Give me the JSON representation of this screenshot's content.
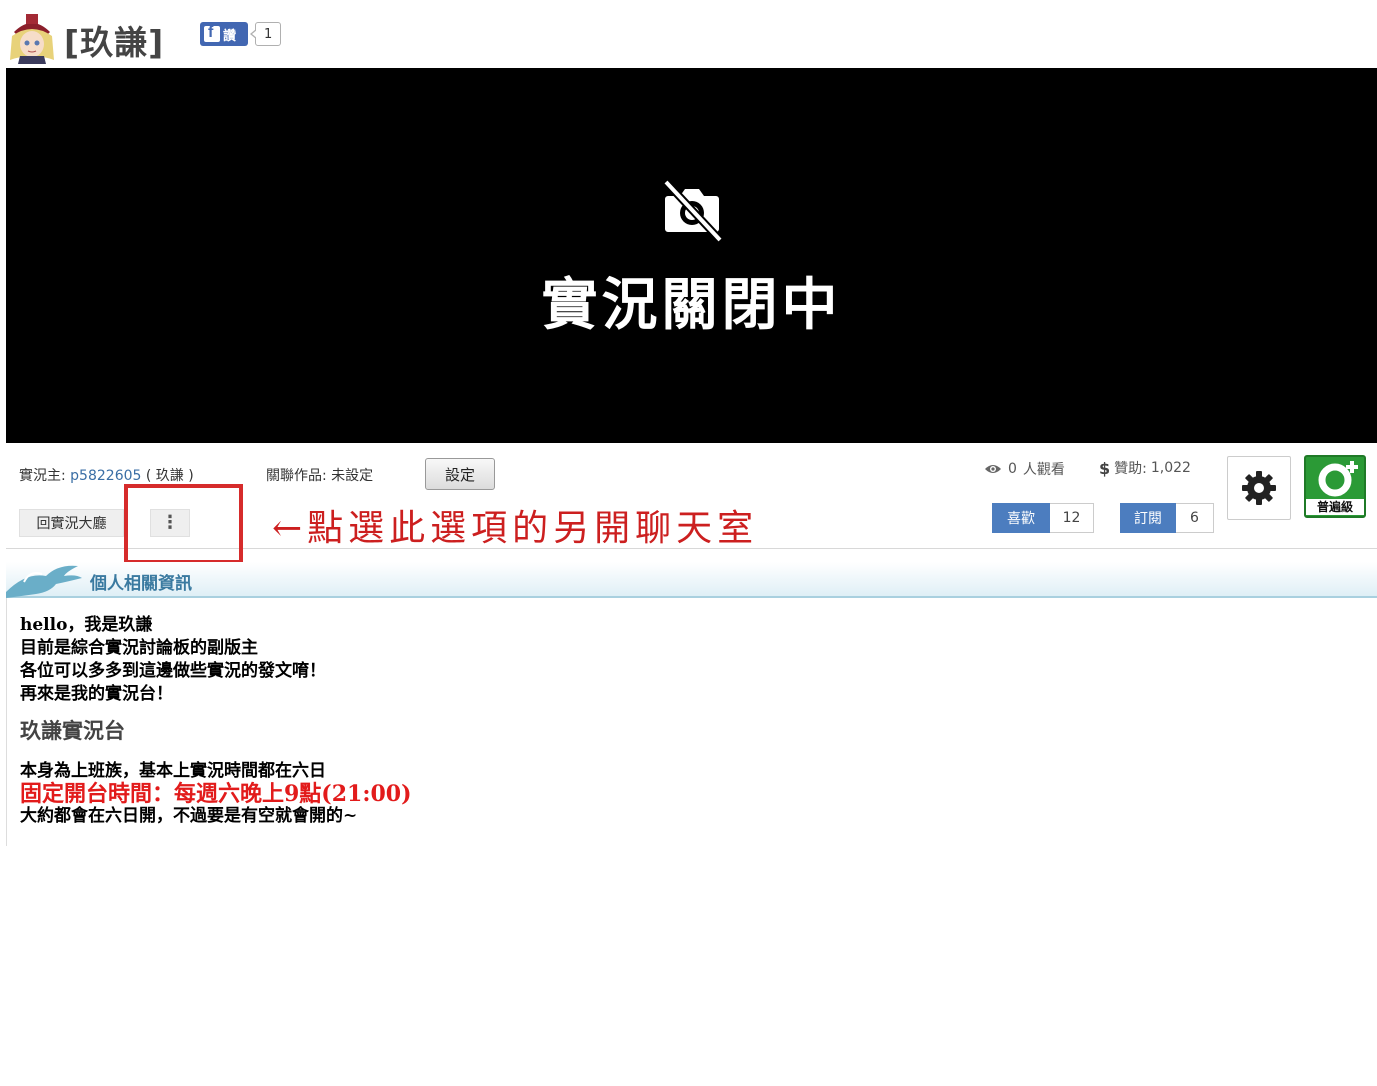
{
  "header": {
    "title": "[玖謙]",
    "fb_label": "讚",
    "fb_count": "1"
  },
  "player": {
    "status_text": "實況關閉中"
  },
  "info": {
    "streamer_label": "實況主:",
    "streamer_id": "p5822605",
    "streamer_name": "( 玖謙 )",
    "related_label": "關聯作品:",
    "related_value": "未設定",
    "set_button": "設定",
    "lobby_button": "回實況大廳",
    "more_button": "⋮",
    "annotation": "←點選此選項的另開聊天室",
    "viewers_count": "0",
    "viewers_label": "人觀看",
    "sponsor_label": "贊助:",
    "sponsor_value": "1,022",
    "like_label": "喜歡",
    "like_count": "12",
    "subscribe_label": "訂閱",
    "subscribe_count": "6",
    "rating_label": "普遍級"
  },
  "section": {
    "title": "個人相關資訊"
  },
  "profile": {
    "lines": [
      "hello，我是玖謙",
      "目前是綜合實況討論板的副版主",
      "各位可以多多到這邊做些實況的發文唷！",
      "再來是我的實況台！"
    ],
    "subtitle": "玖謙實況台",
    "schedule_intro": "本身為上班族，基本上實況時間都在六日",
    "schedule_fixed": "固定開台時間：每週六晚上9點(21:00)",
    "schedule_note": "大約都會在六日開，不過要是有空就會開的~"
  },
  "colors": {
    "accent_blue": "#4c7dbf",
    "annotation_red": "#d62b2b",
    "rating_green": "#2b9a36",
    "section_title": "#3a7aa0"
  }
}
